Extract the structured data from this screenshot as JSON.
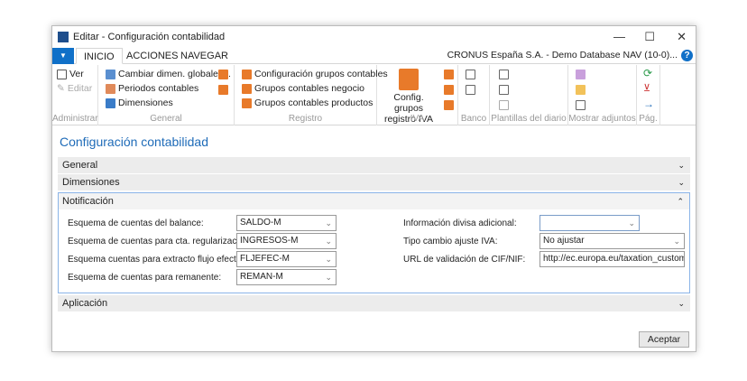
{
  "window": {
    "title": "Editar - Configuración contabilidad",
    "minimize": "—",
    "maximize": "☐",
    "close": "✕"
  },
  "tabs": [
    {
      "label": "INICIO"
    },
    {
      "label": "ACCIONES"
    },
    {
      "label": "NAVEGAR"
    }
  ],
  "company": "CRONUS España S.A. - Demo Database NAV (10-0)...",
  "help": "?",
  "ribbon": {
    "administrar": {
      "label": "Administrar",
      "ver": "Ver",
      "editar": "Editar"
    },
    "general": {
      "label": "General",
      "items": [
        "Cambiar dimen. globales...",
        "Periodos contables",
        "Dimensiones"
      ]
    },
    "registro": {
      "label": "Registro",
      "items": [
        "Configuración grupos contables",
        "Grupos contables negocio",
        "Grupos contables productos"
      ]
    },
    "iva": {
      "label": "IVA",
      "big1": "Config. grupos",
      "big2": "registro IVA"
    },
    "banco": {
      "label": "Banco"
    },
    "plantillas": {
      "label": "Plantillas del diario"
    },
    "adjuntos": {
      "label": "Mostrar adjuntos"
    },
    "pag": {
      "label": "Pág."
    }
  },
  "page_title": "Configuración contabilidad",
  "sections": {
    "general": "General",
    "dimensiones": "Dimensiones",
    "notificacion": "Notificación",
    "aplicacion": "Aplicación"
  },
  "fields": {
    "balance": {
      "label": "Esquema de cuentas del balance:",
      "value": "SALDO-M"
    },
    "regularizacion": {
      "label": "Esquema de cuentas para cta. regularización:",
      "value": "INGRESOS-M"
    },
    "flujo": {
      "label": "Esquema cuentas para extracto flujo efectivo:",
      "value": "FLJEFEC-M"
    },
    "remanente": {
      "label": "Esquema de cuentas para remanente:",
      "value": "REMAN-M"
    },
    "divisa": {
      "label": "Información divisa adicional:",
      "value": ""
    },
    "tipo_cambio": {
      "label": "Tipo cambio ajuste IVA:",
      "value": "No ajustar"
    },
    "url": {
      "label": "URL de validación de CIF/NIF:",
      "value": "http://ec.europa.eu/taxation_custom..."
    }
  },
  "accept": "Aceptar"
}
